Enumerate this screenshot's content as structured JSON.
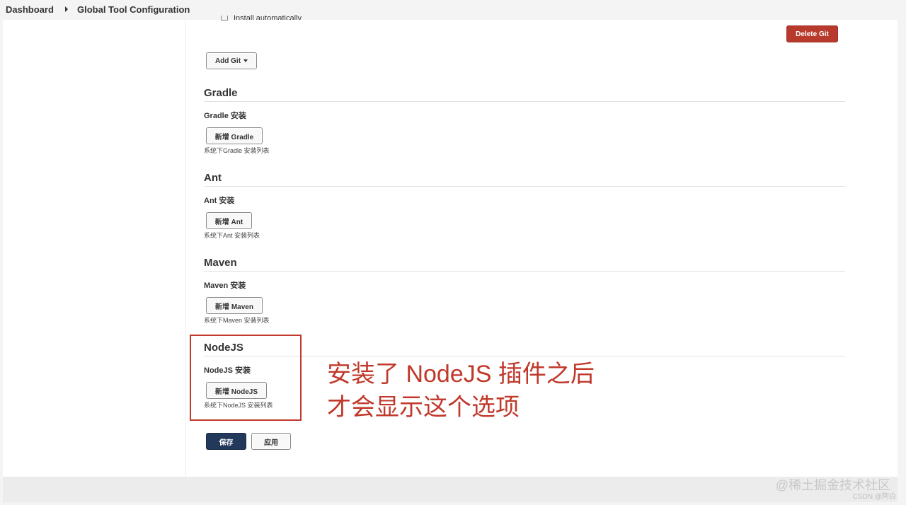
{
  "breadcrumb": {
    "dashboard": "Dashboard",
    "current": "Global Tool Configuration"
  },
  "git": {
    "cut_checkbox_label": "Install automatically",
    "delete_label": "Delete Git",
    "add_label": "Add Git"
  },
  "sections": {
    "gradle": {
      "title": "Gradle",
      "label": "Gradle 安装",
      "button": "新增 Gradle",
      "help": "系统下Gradle 安装列表"
    },
    "ant": {
      "title": "Ant",
      "label": "Ant 安装",
      "button": "新增 Ant",
      "help": "系统下Ant 安装列表"
    },
    "maven": {
      "title": "Maven",
      "label": "Maven 安装",
      "button": "新增 Maven",
      "help": "系统下Maven 安装列表"
    },
    "nodejs": {
      "title": "NodeJS",
      "label": "NodeJS 安装",
      "button": "新增 NodeJS",
      "help": "系统下NodeJS 安装列表"
    }
  },
  "actions": {
    "save": "保存",
    "apply": "应用"
  },
  "annotation": {
    "line1": "安装了 NodeJS 插件之后",
    "line2": "才会显示这个选项"
  },
  "watermark": {
    "line1": "@稀土掘金技术社区",
    "line2": "CSDN @阿白"
  },
  "colors": {
    "danger": "#b73a2c",
    "primary": "#23395b",
    "annotation": "#c0392b"
  }
}
